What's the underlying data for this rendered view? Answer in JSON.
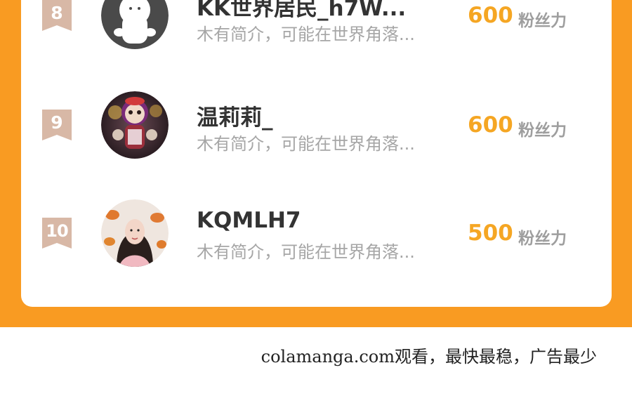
{
  "leaderboard": {
    "rows": [
      {
        "rank": "8",
        "name": "KK世界居民_h7W...",
        "intro": "木有简介，可能在世界角落...",
        "fans_value": "600",
        "fans_label": "粉丝力",
        "avatar_icon": "default-ghost-avatar-icon"
      },
      {
        "rank": "9",
        "name": "温莉莉_",
        "intro": "木有简介，可能在世界角落...",
        "fans_value": "600",
        "fans_label": "粉丝力",
        "avatar_icon": "toy-photo-avatar"
      },
      {
        "rank": "10",
        "name": "KQMLH7",
        "intro": "木有简介，可能在世界角落...",
        "fans_value": "500",
        "fans_label": "粉丝力",
        "avatar_icon": "portrait-photo-avatar"
      }
    ]
  },
  "footer": {
    "text": "colamanga.com观看，最快最稳，广告最少"
  },
  "colors": {
    "panel_orange": "#f99b22",
    "rank_badge": "#d8b8a6",
    "fans_value": "#f5a623"
  }
}
